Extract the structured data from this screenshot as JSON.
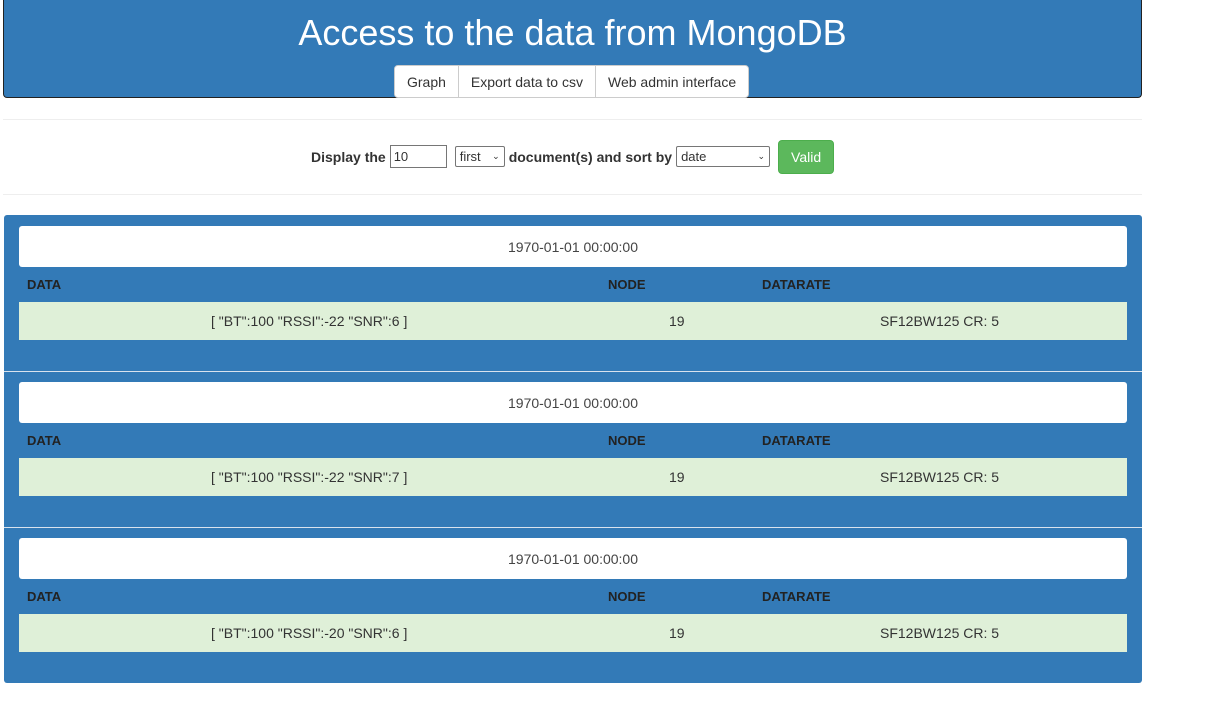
{
  "header": {
    "title": "Access to the data from MongoDB",
    "buttons": [
      "Graph",
      "Export data to csv",
      "Web admin interface"
    ]
  },
  "form": {
    "display_the": "Display the",
    "count_value": "10",
    "order_select": "first",
    "documents_sort_by": "document(s) and sort by",
    "sort_select": "date",
    "valid_label": "Valid"
  },
  "columns": {
    "data": "DATA",
    "node": "NODE",
    "datarate": "DATARATE"
  },
  "records": [
    {
      "date": "1970-01-01 00:00:00",
      "data": "[ \"BT\":100 \"RSSI\":-22 \"SNR\":6 ]",
      "node": "19",
      "datarate": "SF12BW125 CR: 5"
    },
    {
      "date": "1970-01-01 00:00:00",
      "data": "[ \"BT\":100 \"RSSI\":-22 \"SNR\":7 ]",
      "node": "19",
      "datarate": "SF12BW125 CR: 5"
    },
    {
      "date": "1970-01-01 00:00:00",
      "data": "[ \"BT\":100 \"RSSI\":-20 \"SNR\":6 ]",
      "node": "19",
      "datarate": "SF12BW125 CR: 5"
    }
  ],
  "colors": {
    "primary": "#337ab7",
    "success": "#5cb85c",
    "row_bg": "#dff0d8"
  }
}
